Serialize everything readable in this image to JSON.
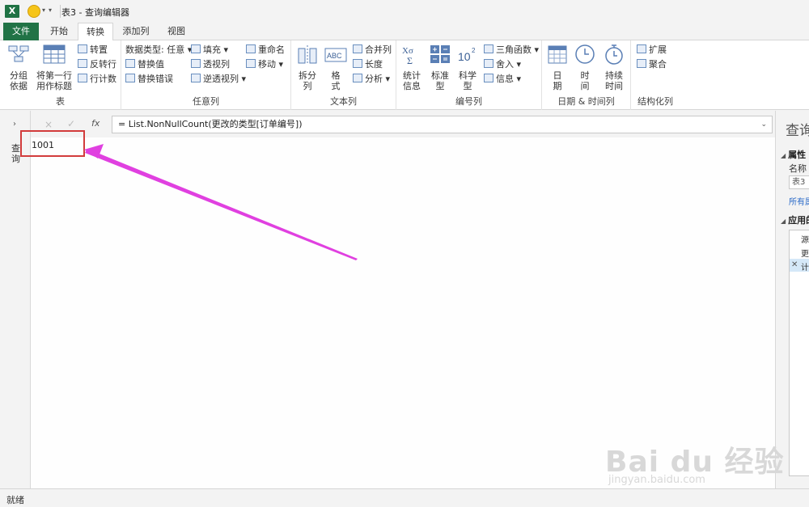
{
  "titlebar": {
    "app_icon": "X",
    "title": "表3 - 查询编辑器"
  },
  "tabs": [
    "文件",
    "开始",
    "转换",
    "添加列",
    "视图"
  ],
  "ribbon": {
    "group_table": {
      "label": "表",
      "group_by_line1": "分组",
      "group_by_line2": "依据",
      "first_row_line1": "将第一行",
      "first_row_line2": "用作标题",
      "transpose": "转置",
      "reverse_rows": "反转行",
      "count_rows": "行计数"
    },
    "group_any_column": {
      "label": "任意列",
      "data_type": "数据类型: 任意",
      "replace_values": "替换值",
      "replace_errors": "替换错误",
      "fill": "填充",
      "pivot": "透视列",
      "unpivot": "逆透视列",
      "rename": "重命名",
      "move": "移动"
    },
    "group_text_column": {
      "label": "文本列",
      "split_line1": "拆分",
      "split_line2": "列",
      "format_line1": "格",
      "format_line2": "式",
      "merge": "合并列",
      "length": "长度",
      "parse": "分析"
    },
    "group_number_column": {
      "label": "编号列",
      "stats_line1": "统计",
      "stats_line2": "信息",
      "standard_line1": "标准",
      "standard_line2": "型",
      "scientific_line1": "科学",
      "scientific_line2": "型",
      "trig": "三角函数",
      "rounding": "舍入",
      "info": "信息"
    },
    "group_datetime": {
      "label": "日期 & 时间列",
      "date_line1": "日",
      "date_line2": "期",
      "time_line1": "时",
      "time_line2": "间",
      "duration_line1": "持续",
      "duration_line2": "时间"
    },
    "group_structured": {
      "label": "结构化列",
      "expand": "扩展",
      "aggregate": "聚合"
    }
  },
  "left_nav": {
    "label": "查询"
  },
  "formula_bar": {
    "cancel": "×",
    "confirm": "✓",
    "fx": "fx",
    "formula": "= List.NonNullCount(更改的类型[订单编号])"
  },
  "grid": {
    "value": "1001"
  },
  "right_panel": {
    "title": "查询",
    "properties_header": "属性",
    "name_label": "名称",
    "name_value": "表3",
    "all_props_link": "所有属",
    "applied_steps_header": "应用的",
    "steps": [
      "源",
      "更",
      "计"
    ]
  },
  "status_bar": {
    "text": "就绪"
  },
  "watermark": {
    "brand": "Bai du 经验",
    "url": "jingyan.baidu.com"
  },
  "colors": {
    "excel_green": "#217346",
    "annotation_magenta": "#e040e0",
    "highlight_red": "#d23c3c"
  }
}
